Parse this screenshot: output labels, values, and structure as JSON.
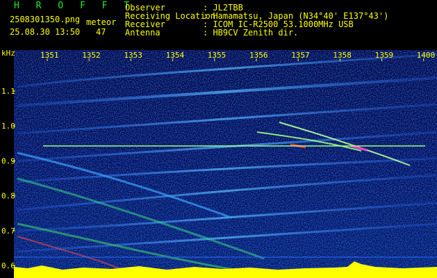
{
  "header": {
    "app": "H R O F F T",
    "filename": "2508301350.png",
    "mode_label": "meteor",
    "datetime": "25.08.30 13:50",
    "count": "47",
    "fields": [
      {
        "label": "Observer",
        "value": ": JL2TBB"
      },
      {
        "label": "Receiving Location",
        "value": ": Hamamatsu, Japan (N34°40' E137°43')"
      },
      {
        "label": "Receiver",
        "value": ": ICOM IC-R2500 53.1000MHz USB"
      },
      {
        "label": "Antenna",
        "value": ": HB9CV Zenith dir."
      }
    ]
  },
  "axis": {
    "unit": "kHz",
    "time_ticks": [
      "1351",
      "1352",
      "1353",
      "1354",
      "1355",
      "1356",
      "1357",
      "1358",
      "1359",
      "1400"
    ],
    "freq_ticks": [
      "1.1",
      "1.0",
      "0.9",
      "0.8",
      "0.7",
      "0.6"
    ]
  },
  "colors": {
    "background": "#000000",
    "noise_dark": "#00004a",
    "noise_mid": "#1f5aff",
    "signal_hot": "#ff2020",
    "carrier": "#9cff80",
    "floor": "#ffff00",
    "text_green": "#22ee22",
    "text_yellow": "#ffff00"
  }
}
